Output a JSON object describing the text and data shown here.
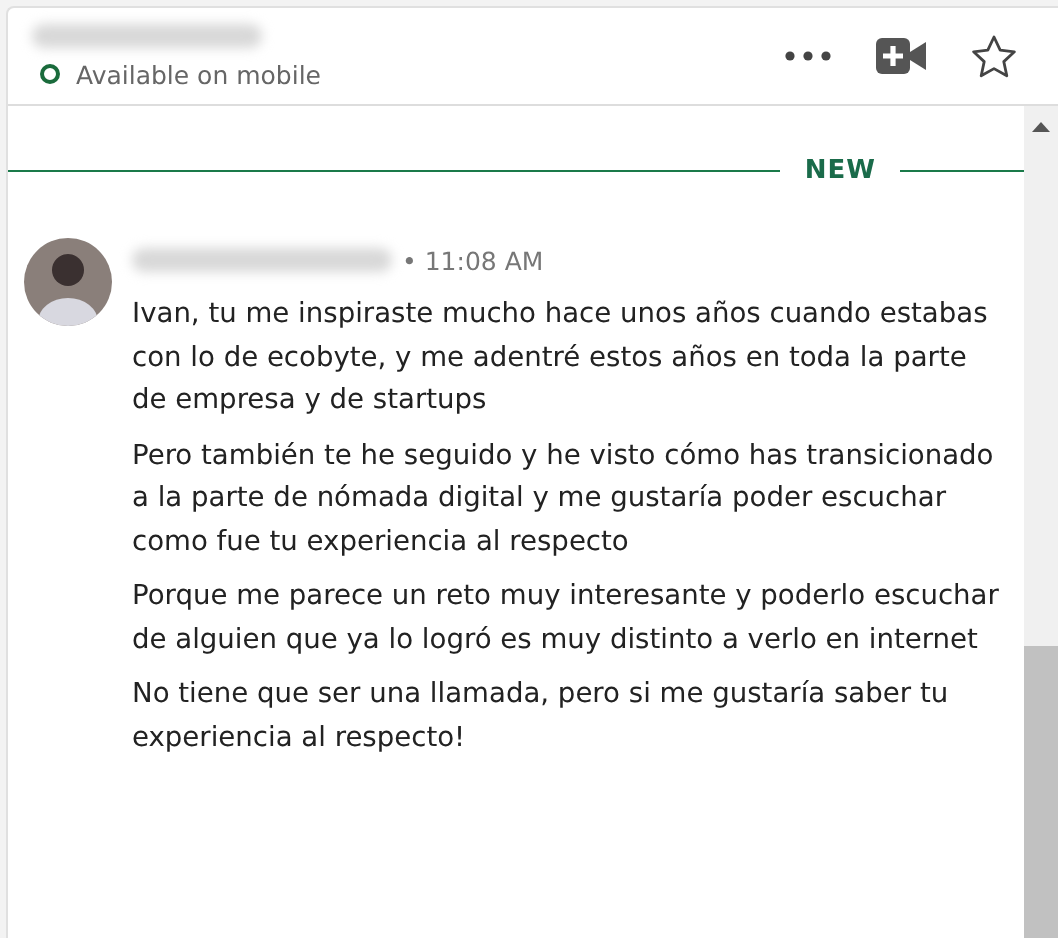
{
  "header": {
    "status": "Available on mobile"
  },
  "divider": {
    "label": "NEW"
  },
  "message": {
    "separator": "•",
    "time": "11:08 AM",
    "paragraphs": [
      "Ivan, tu me inspiraste mucho hace unos años cuando estabas con lo de ecobyte, y me adentré estos años en toda la parte de empresa y de startups",
      "Pero también te he seguido y he visto cómo has transicionado a la parte de nómada digital y me gustaría poder escuchar como fue tu experiencia al respecto",
      "Porque me parece un reto muy interesante y poderlo escuchar de alguien que ya lo logró es muy distinto a verlo en internet",
      "No tiene que ser una llamada, pero si me gustaría saber tu experiencia al respecto!"
    ]
  }
}
